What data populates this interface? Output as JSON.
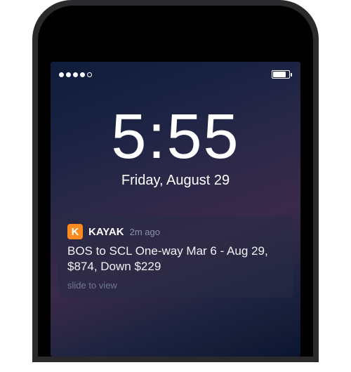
{
  "status_bar": {
    "signal_filled": 4,
    "signal_total": 5
  },
  "lock_screen": {
    "time": "5:55",
    "date": "Friday, August 29"
  },
  "notification": {
    "app_icon_letter": "K",
    "app_name": "KAYAK",
    "time_ago": "2m ago",
    "message": "BOS to SCL One-way Mar 6 - Aug 29, $874, Down $229",
    "slide_hint": "slide to view"
  },
  "colors": {
    "accent": "#ff8a1f"
  }
}
